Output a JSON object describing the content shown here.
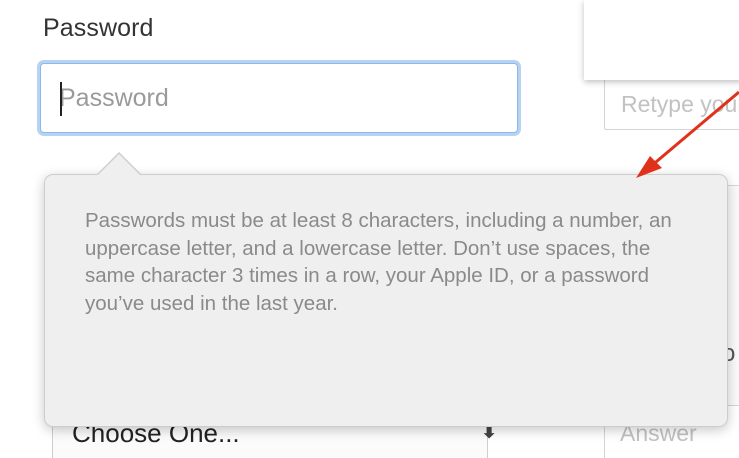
{
  "form": {
    "password_label": "Password",
    "password_placeholder": "Password",
    "password_value": "",
    "retype_placeholder": "Retype your password"
  },
  "tooltip": {
    "text": "Passwords must be at least 8 characters, including a number, an uppercase letter, and a lowercase letter. Don’t use spaces, the same character 3 times in a row, your Apple ID, or a password you’ve used in the last year."
  },
  "background": {
    "security_question_select": "Choose One...",
    "answer_placeholder": "Answer",
    "right_field_fragment": "o"
  },
  "colors": {
    "focus_ring": "#b7d3f3",
    "tooltip_bg": "#efefef",
    "tooltip_text": "#8a8a8a",
    "annotation_arrow": "#e0321b"
  },
  "icons": {
    "select_chevron": "chevron-up-down-icon",
    "annotation": "red-arrow-icon"
  }
}
